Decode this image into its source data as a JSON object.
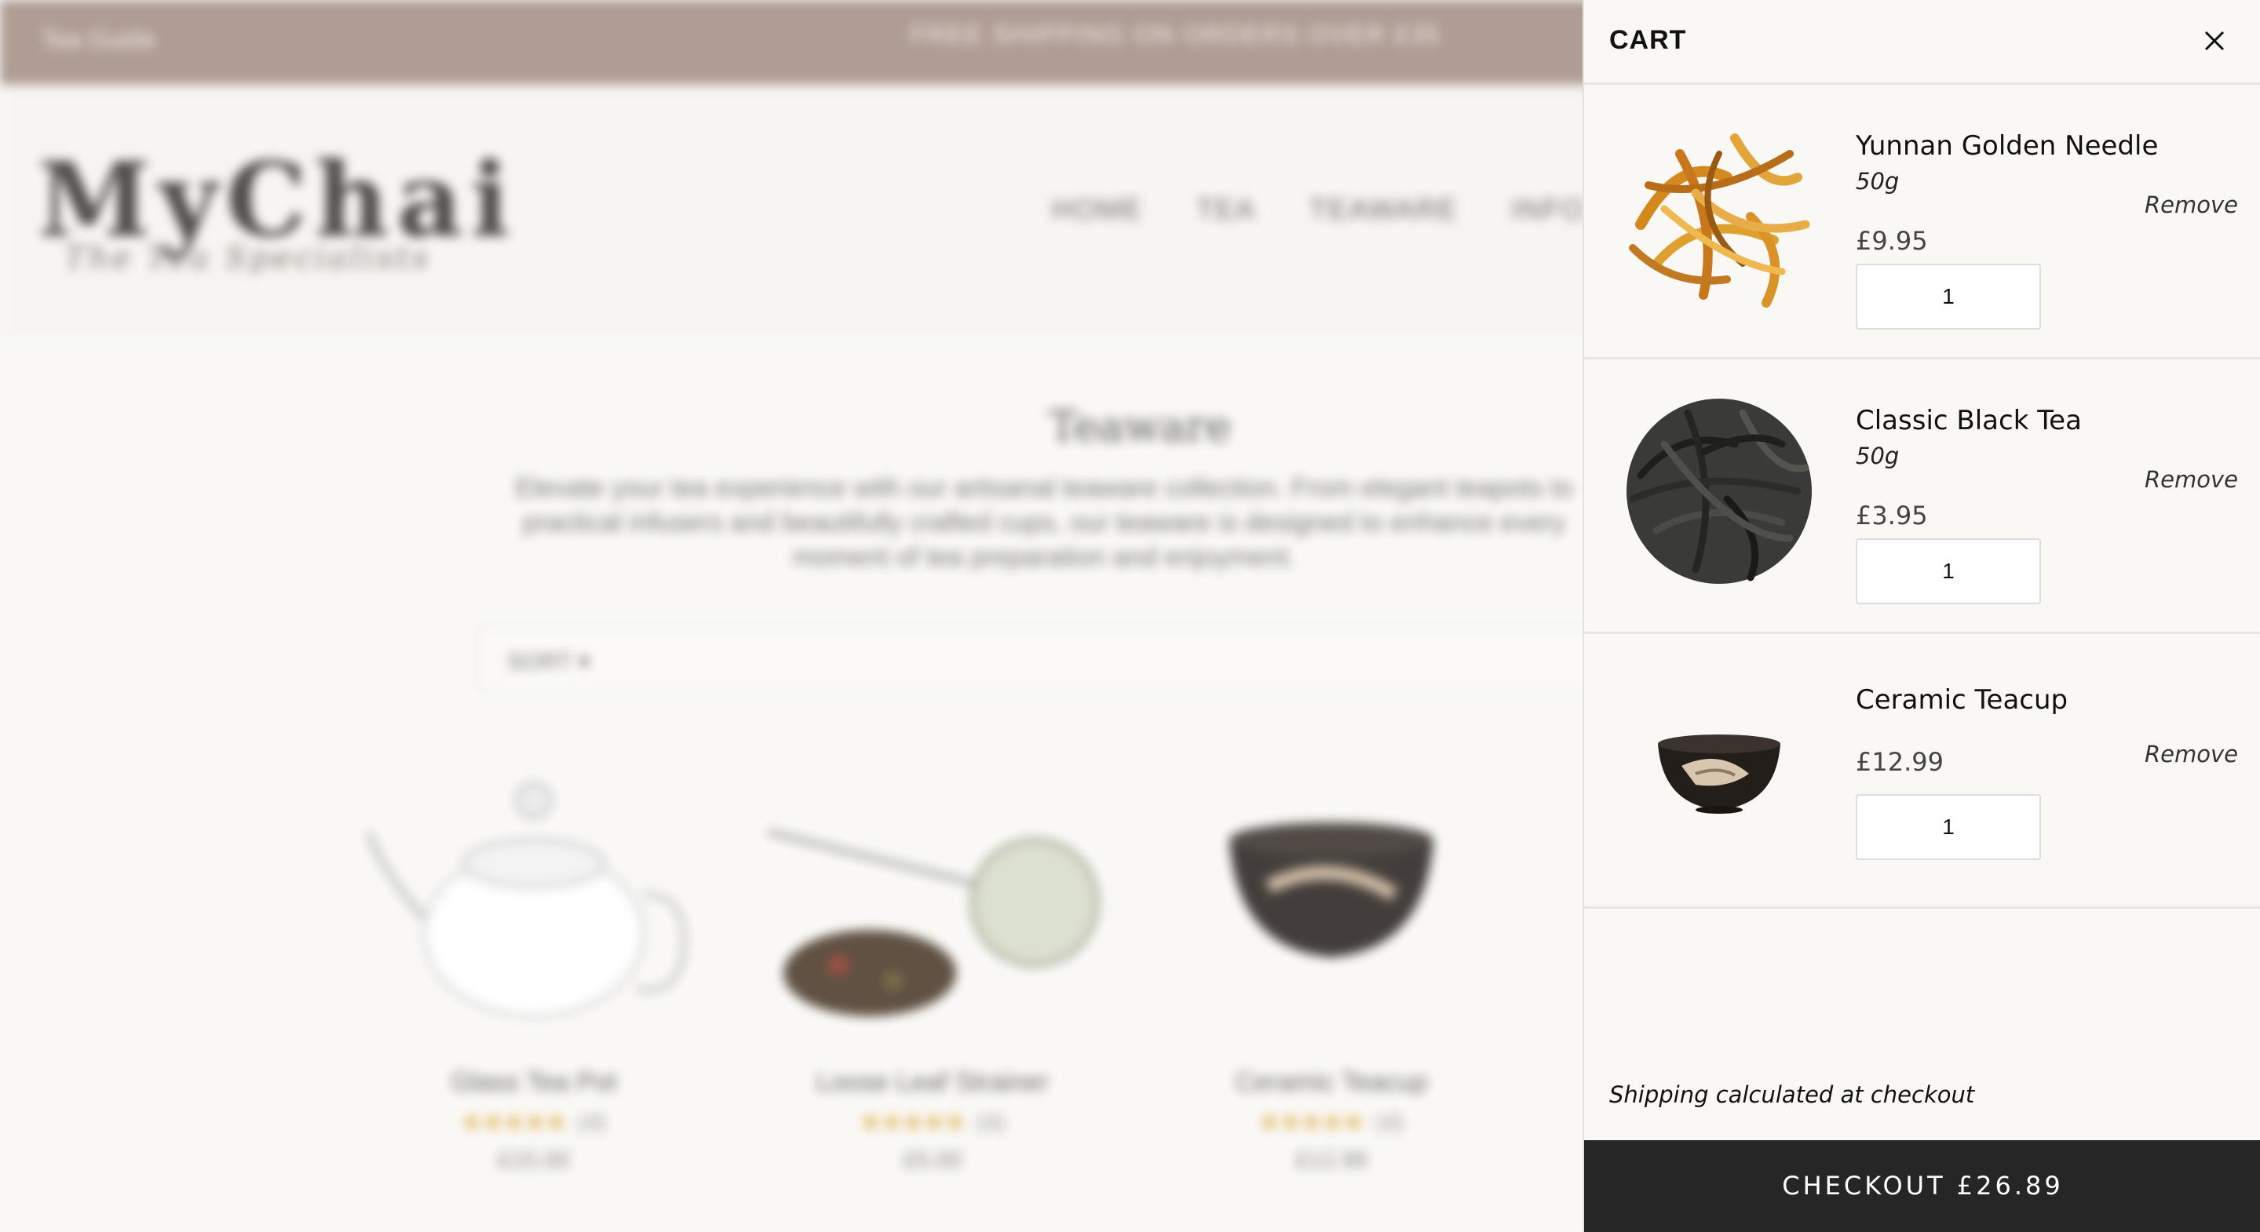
{
  "background": {
    "announcement_left": "Tea Guide",
    "announcement_center": "FREE SHIPPING ON ORDERS OVER £35",
    "logo": "MyChai",
    "tagline": "The Tea Specialists",
    "nav": [
      "HOME",
      "TEA",
      "TEAWARE",
      "INFO"
    ],
    "page_title": "Teaware",
    "page_description": "Elevate your tea experience with our artisanal teaware collection. From elegant teapots to practical infusers and beautifully crafted cups, our teaware is designed to enhance every moment of tea preparation and enjoyment.",
    "sort_label": "SORT ▾",
    "products": [
      {
        "name": "Glass Tea Pot",
        "stars": "★★★★★",
        "reviews": "(4)",
        "price": "£15.00"
      },
      {
        "name": "Loose Leaf Strainer",
        "stars": "★★★★★",
        "reviews": "(4)",
        "price": "£5.00"
      },
      {
        "name": "Ceramic Teacup",
        "stars": "★★★★★",
        "reviews": "(4)",
        "price": "£12.99"
      }
    ]
  },
  "cart": {
    "title": "CART",
    "close_icon": "close-icon",
    "items": [
      {
        "name": "Yunnan Golden Needle",
        "variant": "50g",
        "price": "£9.95",
        "quantity": "1",
        "remove_label": "Remove",
        "image": "golden-tea-leaves"
      },
      {
        "name": "Classic Black Tea",
        "variant": "50g",
        "price": "£3.95",
        "quantity": "1",
        "remove_label": "Remove",
        "image": "black-tea-leaves"
      },
      {
        "name": "Ceramic Teacup",
        "variant": "",
        "price": "£12.99",
        "quantity": "1",
        "remove_label": "Remove",
        "image": "ceramic-teacup"
      }
    ],
    "shipping_note": "Shipping calculated at checkout",
    "checkout_label": "CHECKOUT £26.89"
  },
  "colors": {
    "announcement_bg": "#a48f86",
    "checkout_bg": "#262626",
    "drawer_bg": "#f9f8f5"
  }
}
